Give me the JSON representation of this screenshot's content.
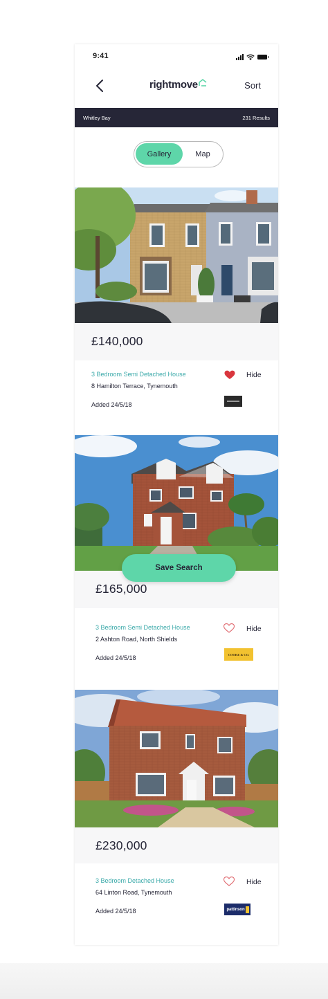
{
  "status_bar": {
    "time": "9:41",
    "icons": [
      "signal-icon",
      "wifi-icon",
      "battery-icon"
    ]
  },
  "nav": {
    "back_icon": "chevron-left-icon",
    "logo_text": "rightmove",
    "logo_icon": "house-outline-icon",
    "sort_label": "Sort"
  },
  "location_bar": {
    "location": "Whitley Bay",
    "results": "231 Results"
  },
  "view_toggle": {
    "gallery_label": "Gallery",
    "map_label": "Map",
    "selected": "Gallery"
  },
  "listings": [
    {
      "price": "£140,000",
      "type": "3 Bedroom Semi Detached House",
      "address": "8 Hamilton Terrace, Tynemouth",
      "added": "Added 24/5/18",
      "favourited": true,
      "hide_label": "Hide",
      "image": "terraced-brick-houses-photo",
      "agent": {
        "name": "",
        "style": "dark"
      }
    },
    {
      "price": "£165,000",
      "type": "3 Bedroom Semi Detached House",
      "address": "2 Ashton Road, North Shields",
      "added": "Added 24/5/18",
      "favourited": false,
      "hide_label": "Hide",
      "image": "semi-detached-brick-house-photo",
      "agent": {
        "name": "COOKE & CO.",
        "style": "yellow"
      }
    },
    {
      "price": "£230,000",
      "type": "3 Bedroom Detached House",
      "address": "64 Linton Road, Tynemouth",
      "added": "Added 24/5/18",
      "favourited": false,
      "hide_label": "Hide",
      "image": "detached-brick-house-photo",
      "agent": {
        "name": "pattinson",
        "style": "navy"
      }
    }
  ],
  "save_search_label": "Save Search",
  "colors": {
    "accent_green": "#5ed6a9",
    "navy": "#262637",
    "teal_link": "#3aa9a9",
    "heart_red": "#d9363e"
  }
}
